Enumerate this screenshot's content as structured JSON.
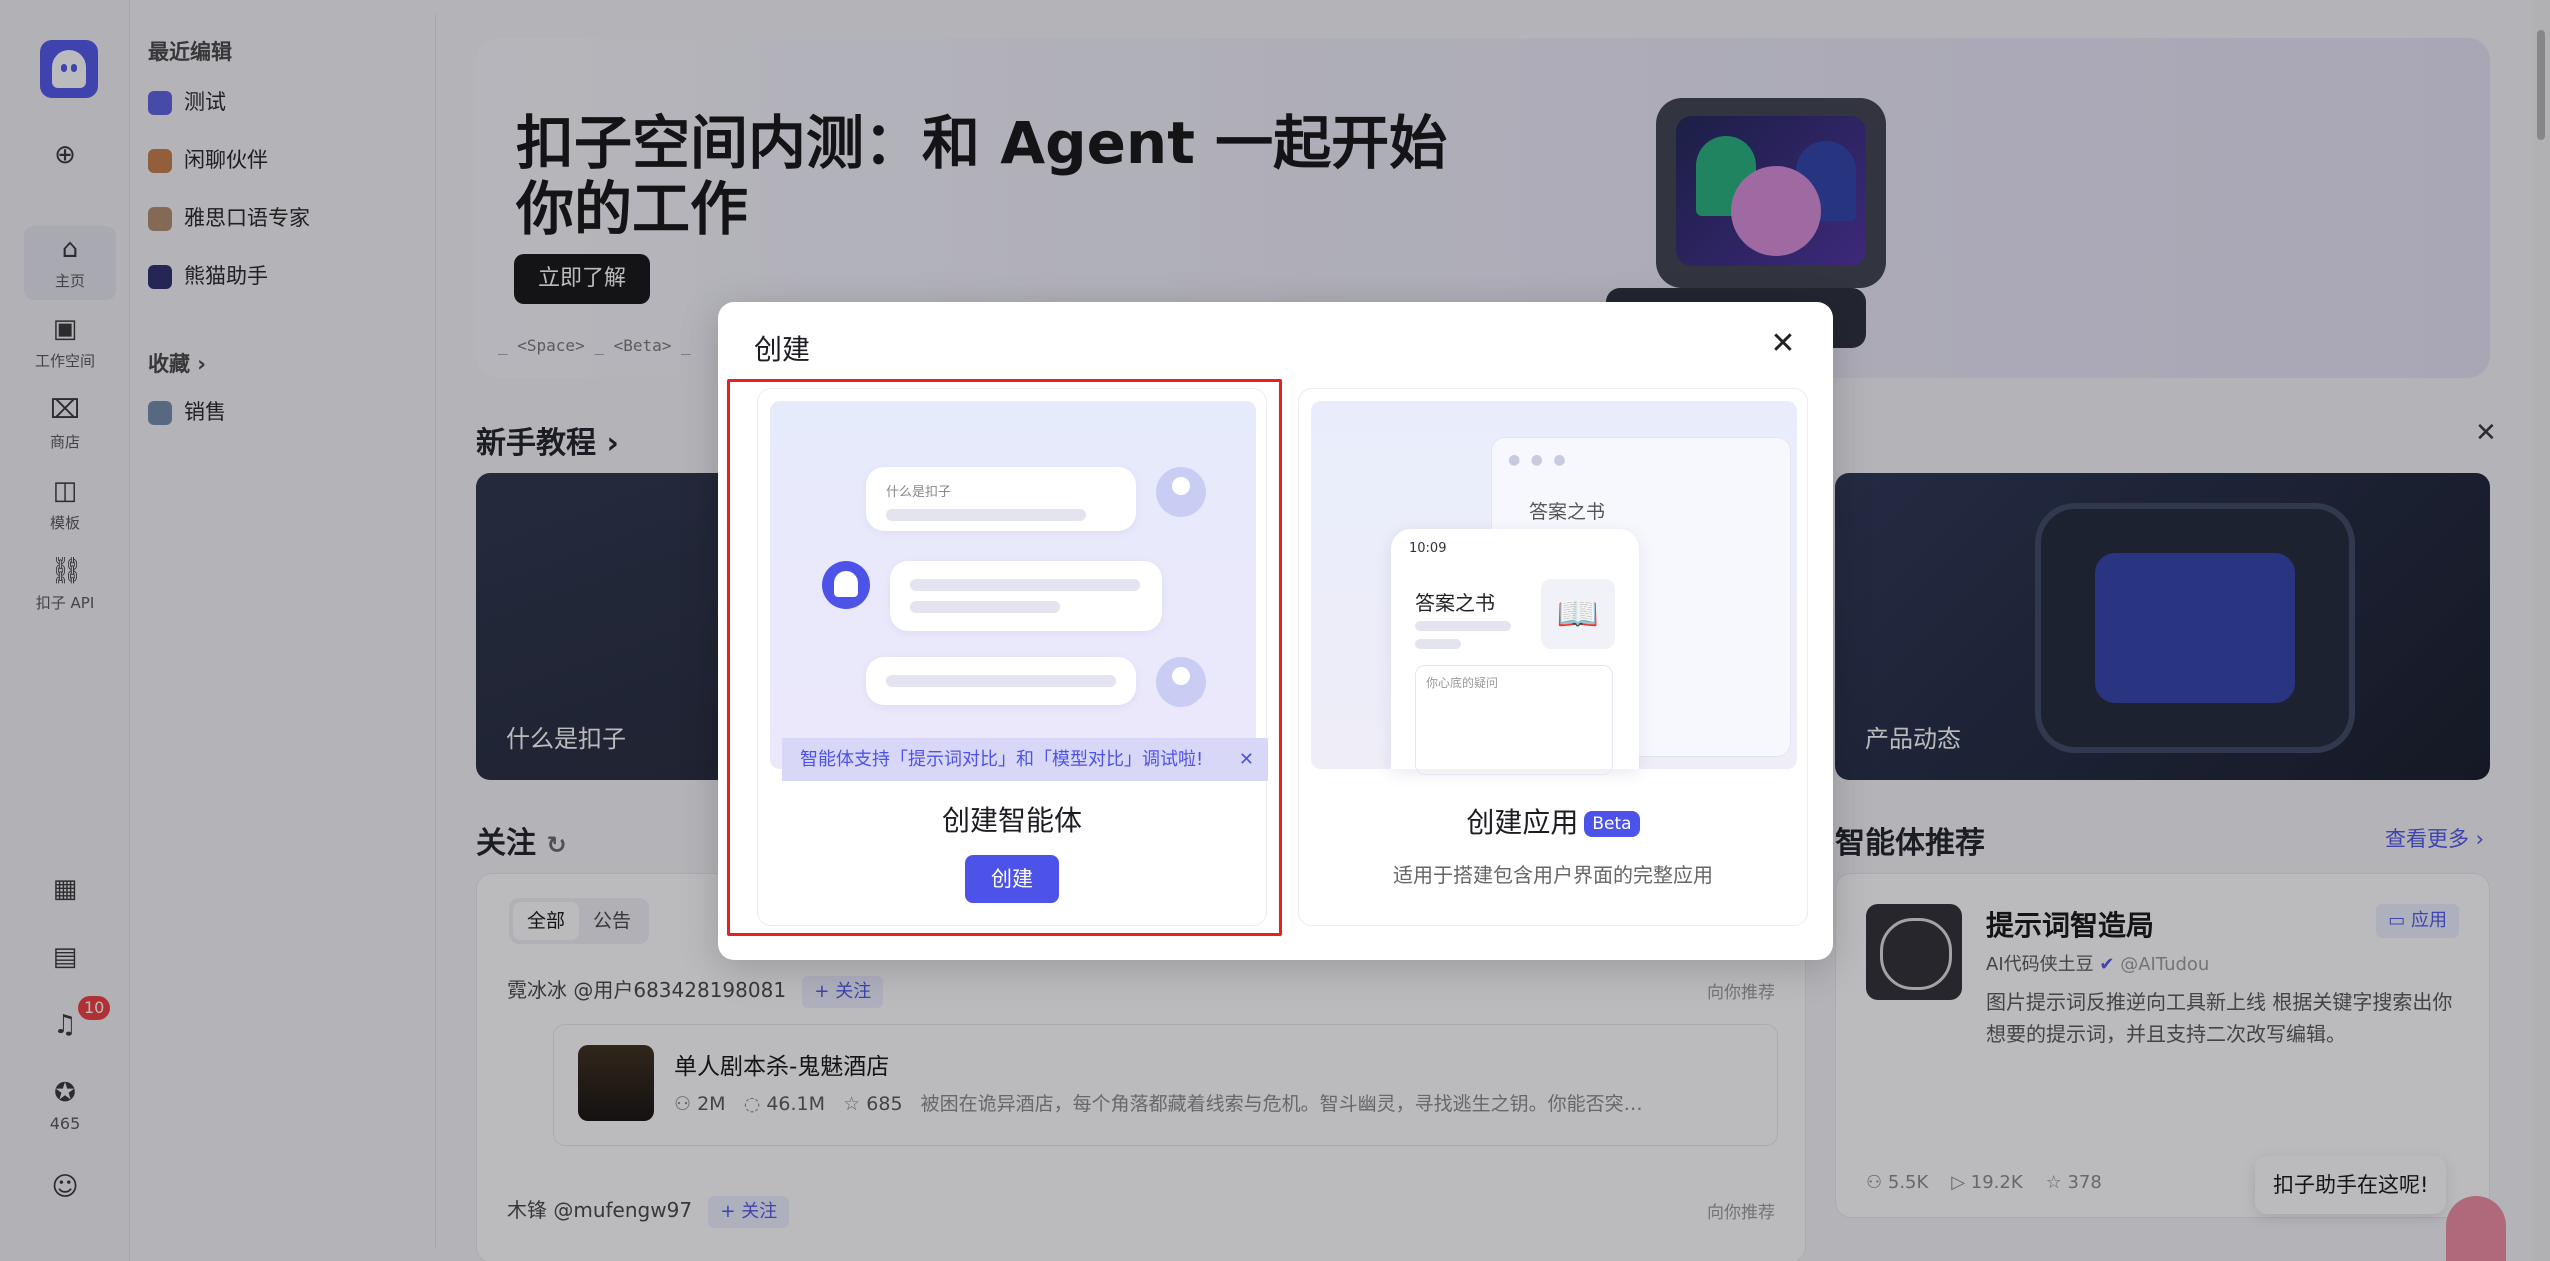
{
  "rail": {
    "items": [
      {
        "label": "主页"
      },
      {
        "label": "工作空间"
      },
      {
        "label": "商店"
      },
      {
        "label": "模板"
      },
      {
        "label": "扣子 API"
      }
    ],
    "notifications_count": "10",
    "points": "465"
  },
  "sidebar": {
    "recent_title": "最近编辑",
    "recent": [
      {
        "label": "测试",
        "color": "#5b5ee0"
      },
      {
        "label": "闲聊伙伴",
        "color": "#c57a45"
      },
      {
        "label": "雅思口语专家",
        "color": "#b08a6a"
      },
      {
        "label": "熊猫助手",
        "color": "#2a2a6a"
      }
    ],
    "favorites_title": "收藏",
    "favorites": [
      {
        "label": "销售",
        "color": "#6f8aa8"
      }
    ]
  },
  "banner": {
    "title": "扣子空间内测：和 Agent 一起开始你的工作",
    "button": "立即了解",
    "tag": "_ <Space> _ <Beta> _"
  },
  "tutorial": {
    "title": "新手教程",
    "card1": "什么是扣子",
    "card3": "产品动态"
  },
  "follow": {
    "title": "关注",
    "tabs": [
      "全部",
      "公告"
    ],
    "feed": [
      {
        "user": "霓冰冰 @用户683428198081",
        "follow_label": "+ 关注",
        "recommend": "向你推荐",
        "card_name": "单人剧本杀-鬼魅酒店",
        "users": "2M",
        "conversations": "46.1M",
        "stars": "685",
        "desc": "被困在诡异酒店，每个角落都藏着线索与危机。智斗幽灵，寻找逃生之钥。你能否突…"
      },
      {
        "user": "木锋 @mufengw97",
        "follow_label": "+ 关注",
        "recommend": "向你推荐"
      }
    ]
  },
  "agents": {
    "title": "智能体推荐",
    "more": "查看更多",
    "card": {
      "name": "提示词智造局",
      "tag": "应用",
      "author": "AI代码侠土豆",
      "handle": "@AITudou",
      "desc": "图片提示词反推逆向工具新上线 根据关键字搜索出你想要的提示词，并且支持二次改写编辑。",
      "users": "5.5K",
      "runs": "19.2K",
      "stars": "378"
    }
  },
  "helper": "扣子助手在这呢!",
  "modal": {
    "title": "创建",
    "option1": {
      "name": "创建智能体",
      "button": "创建",
      "notice": "智能体支持「提示词对比」和「模型对比」调试啦!",
      "preview_question": "什么是扣子"
    },
    "option2": {
      "name": "创建应用",
      "badge": "Beta",
      "desc": "适用于搭建包含用户界面的完整应用",
      "window_title": "答案之书",
      "phone_time": "10:09",
      "phone_title": "答案之书",
      "phone_input": "你心底的疑问"
    }
  }
}
